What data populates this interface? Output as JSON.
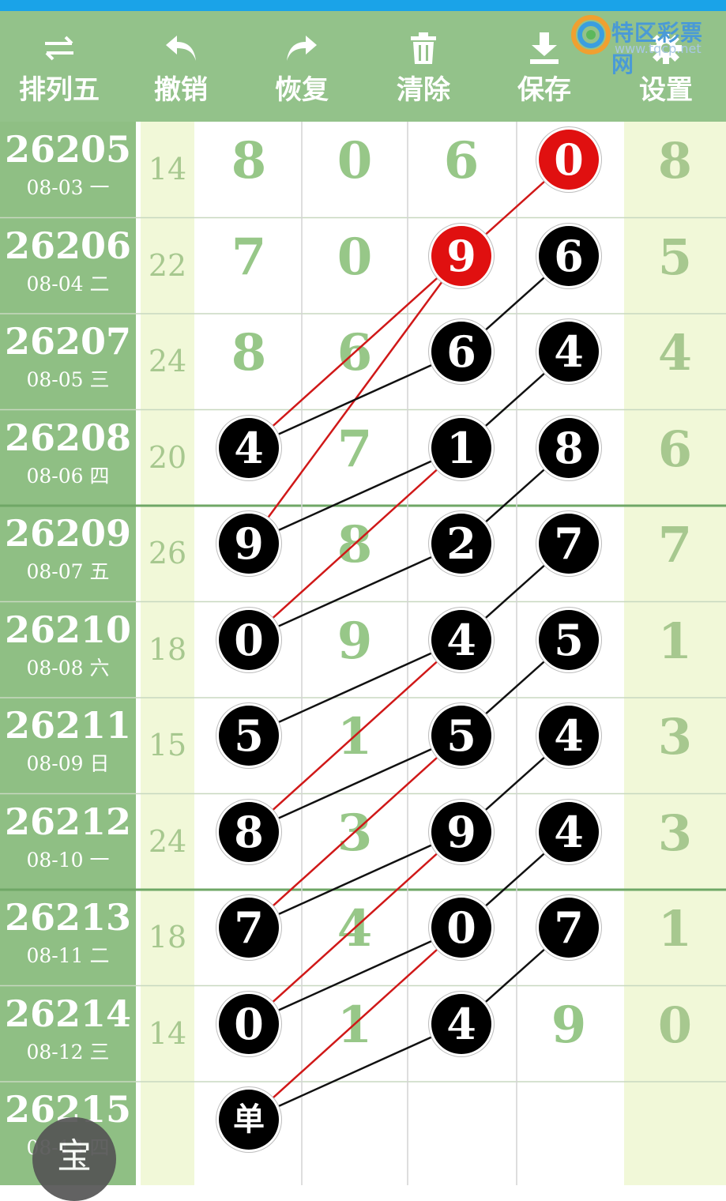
{
  "toolbar": {
    "items": [
      {
        "label": "排列五",
        "icon": "swap-arrows-icon"
      },
      {
        "label": "撤销",
        "icon": "undo-icon"
      },
      {
        "label": "恢复",
        "icon": "redo-icon"
      },
      {
        "label": "清除",
        "icon": "trash-icon"
      },
      {
        "label": "保存",
        "icon": "download-icon"
      },
      {
        "label": "设置",
        "icon": "gear-icon"
      }
    ]
  },
  "watermark": {
    "name": "特区彩票网",
    "url": "www.tqcp.net"
  },
  "rows": [
    {
      "period": "26205",
      "date": "08-03 一",
      "sum": "14",
      "digits": [
        "8",
        "0",
        "6",
        "0"
      ],
      "tail": "8"
    },
    {
      "period": "26206",
      "date": "08-04 二",
      "sum": "22",
      "digits": [
        "7",
        "0",
        "9",
        "6"
      ],
      "tail": "5"
    },
    {
      "period": "26207",
      "date": "08-05 三",
      "sum": "24",
      "digits": [
        "8",
        "6",
        "6",
        "4"
      ],
      "tail": "4"
    },
    {
      "period": "26208",
      "date": "08-06 四",
      "sum": "20",
      "digits": [
        "4",
        "7",
        "1",
        "8"
      ],
      "tail": "6"
    },
    {
      "period": "26209",
      "date": "08-07 五",
      "sum": "26",
      "digits": [
        "9",
        "8",
        "2",
        "7"
      ],
      "tail": "7"
    },
    {
      "period": "26210",
      "date": "08-08 六",
      "sum": "18",
      "digits": [
        "0",
        "9",
        "4",
        "5"
      ],
      "tail": "1"
    },
    {
      "period": "26211",
      "date": "08-09 日",
      "sum": "15",
      "digits": [
        "5",
        "1",
        "5",
        "4"
      ],
      "tail": "3"
    },
    {
      "period": "26212",
      "date": "08-10 一",
      "sum": "24",
      "digits": [
        "8",
        "3",
        "9",
        "4"
      ],
      "tail": "3"
    },
    {
      "period": "26213",
      "date": "08-11 二",
      "sum": "18",
      "digits": [
        "7",
        "4",
        "0",
        "7"
      ],
      "tail": "1"
    },
    {
      "period": "26214",
      "date": "08-12 三",
      "sum": "14",
      "digits": [
        "0",
        "1",
        "4",
        "9"
      ],
      "tail": "0"
    },
    {
      "period": "26215",
      "date": "08-13 四",
      "sum": "",
      "digits": [
        "",
        "",
        "",
        ""
      ],
      "tail": ""
    }
  ],
  "marks": [
    {
      "row": 0,
      "col": 3,
      "style": "red"
    },
    {
      "row": 1,
      "col": 2,
      "style": "red"
    },
    {
      "row": 1,
      "col": 3,
      "style": "black"
    },
    {
      "row": 2,
      "col": 2,
      "style": "black"
    },
    {
      "row": 2,
      "col": 3,
      "style": "black"
    },
    {
      "row": 3,
      "col": 0,
      "style": "black"
    },
    {
      "row": 3,
      "col": 2,
      "style": "black"
    },
    {
      "row": 3,
      "col": 3,
      "style": "black"
    },
    {
      "row": 4,
      "col": 0,
      "style": "black"
    },
    {
      "row": 4,
      "col": 2,
      "style": "black"
    },
    {
      "row": 4,
      "col": 3,
      "style": "black"
    },
    {
      "row": 5,
      "col": 0,
      "style": "black"
    },
    {
      "row": 5,
      "col": 2,
      "style": "black"
    },
    {
      "row": 5,
      "col": 3,
      "style": "black"
    },
    {
      "row": 6,
      "col": 0,
      "style": "black"
    },
    {
      "row": 6,
      "col": 2,
      "style": "black"
    },
    {
      "row": 6,
      "col": 3,
      "style": "black"
    },
    {
      "row": 7,
      "col": 0,
      "style": "black"
    },
    {
      "row": 7,
      "col": 2,
      "style": "black"
    },
    {
      "row": 7,
      "col": 3,
      "style": "black"
    },
    {
      "row": 8,
      "col": 0,
      "style": "black"
    },
    {
      "row": 8,
      "col": 2,
      "style": "black"
    },
    {
      "row": 8,
      "col": 3,
      "style": "black"
    },
    {
      "row": 9,
      "col": 0,
      "style": "black"
    },
    {
      "row": 9,
      "col": 2,
      "style": "black"
    },
    {
      "row": 10,
      "col": 0,
      "style": "single",
      "text": "单"
    }
  ],
  "lines": [
    {
      "color": "#d01818",
      "from": [
        0,
        3
      ],
      "to": [
        3,
        0
      ]
    },
    {
      "color": "#d01818",
      "from": [
        1,
        2
      ],
      "to": [
        4,
        0
      ]
    },
    {
      "color": "#d01818",
      "from": [
        3,
        2
      ],
      "to": [
        5,
        0
      ]
    },
    {
      "color": "#d01818",
      "from": [
        5,
        2
      ],
      "to": [
        7,
        0
      ]
    },
    {
      "color": "#d01818",
      "from": [
        6,
        2
      ],
      "to": [
        8,
        0
      ]
    },
    {
      "color": "#d01818",
      "from": [
        8,
        2
      ],
      "to": [
        10,
        0
      ]
    },
    {
      "color": "#d01818",
      "from": [
        7,
        2
      ],
      "to": [
        9,
        0
      ]
    },
    {
      "color": "#111111",
      "from": [
        1,
        3
      ],
      "to": [
        2,
        2
      ]
    },
    {
      "color": "#111111",
      "from": [
        2,
        2
      ],
      "to": [
        3,
        0
      ]
    },
    {
      "color": "#111111",
      "from": [
        2,
        3
      ],
      "to": [
        3,
        2
      ]
    },
    {
      "color": "#111111",
      "from": [
        3,
        2
      ],
      "to": [
        4,
        0
      ]
    },
    {
      "color": "#111111",
      "from": [
        3,
        3
      ],
      "to": [
        4,
        2
      ]
    },
    {
      "color": "#111111",
      "from": [
        4,
        2
      ],
      "to": [
        5,
        0
      ]
    },
    {
      "color": "#111111",
      "from": [
        4,
        3
      ],
      "to": [
        5,
        2
      ]
    },
    {
      "color": "#111111",
      "from": [
        5,
        2
      ],
      "to": [
        6,
        0
      ]
    },
    {
      "color": "#111111",
      "from": [
        5,
        3
      ],
      "to": [
        6,
        2
      ]
    },
    {
      "color": "#111111",
      "from": [
        6,
        2
      ],
      "to": [
        7,
        0
      ]
    },
    {
      "color": "#111111",
      "from": [
        6,
        3
      ],
      "to": [
        7,
        2
      ]
    },
    {
      "color": "#111111",
      "from": [
        7,
        2
      ],
      "to": [
        8,
        0
      ]
    },
    {
      "color": "#111111",
      "from": [
        7,
        3
      ],
      "to": [
        8,
        2
      ]
    },
    {
      "color": "#111111",
      "from": [
        8,
        2
      ],
      "to": [
        9,
        0
      ]
    },
    {
      "color": "#111111",
      "from": [
        8,
        3
      ],
      "to": [
        9,
        2
      ]
    },
    {
      "color": "#111111",
      "from": [
        9,
        2
      ],
      "to": [
        10,
        0
      ]
    }
  ],
  "treasure": {
    "label": "宝"
  },
  "colors": {
    "header_green": "#93c28a",
    "period_green": "#8fbf84",
    "light_column": "#f1f8d8",
    "digit_green": "#97c788",
    "red_ball": "#e01010"
  }
}
